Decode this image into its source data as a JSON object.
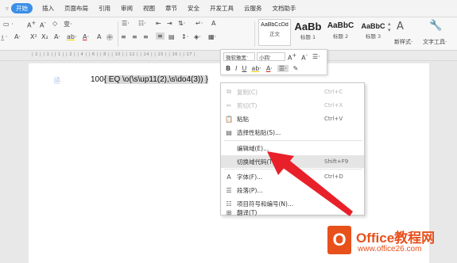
{
  "menubar": {
    "tabs": [
      "开始",
      "插入",
      "页面布局",
      "引用",
      "审阅",
      "视图",
      "章节",
      "安全",
      "开发工具",
      "云服务",
      "文档助手"
    ],
    "active_tab": "开始",
    "accent": "#3a8ee6"
  },
  "ribbon": {
    "styles": [
      {
        "sample": "AaBbCcDd",
        "name": "正文"
      },
      {
        "sample": "AaBb",
        "name": "标题 1"
      },
      {
        "sample": "AaBbC",
        "name": "标题 2"
      },
      {
        "sample": "AaBbC",
        "name": "标题 3"
      }
    ],
    "new_style_label": "新样式",
    "text_tools_label": "文字工具"
  },
  "ruler": {
    "marks": "| 2 | | 1 | | 1 | | 2 | | 4 | | 6 | | 8 | | 10 | | 12 | | 14 | | 15 | | 16 | | 17 |"
  },
  "document": {
    "line_prefix": "100",
    "field_code": "{ EQ \\o(\\s\\up11(2),\\s\\do4(3)) }"
  },
  "mini_toolbar": {
    "font_name": "微软雅黑",
    "font_size": "小四"
  },
  "context_menu": {
    "items": [
      {
        "label": "复制(C)",
        "shortcut": "Ctrl+C",
        "disabled": true,
        "icon": "copy-icon"
      },
      {
        "label": "剪切(T)",
        "shortcut": "Ctrl+X",
        "disabled": true,
        "icon": "cut-icon"
      },
      {
        "label": "粘贴",
        "shortcut": "Ctrl+V",
        "disabled": false,
        "icon": "paste-icon"
      },
      {
        "label": "选择性粘贴(S)...",
        "shortcut": "",
        "disabled": false,
        "icon": "paste-special-icon"
      },
      {
        "label": "编辑域(E)...",
        "shortcut": "",
        "disabled": false,
        "icon": ""
      },
      {
        "label": "切换域代码(T)",
        "shortcut": "Shift+F9",
        "disabled": false,
        "icon": "",
        "highlighted": true
      },
      {
        "label": "字体(F)...",
        "shortcut": "Ctrl+D",
        "disabled": false,
        "icon": "font-icon"
      },
      {
        "label": "段落(P)...",
        "shortcut": "",
        "disabled": false,
        "icon": "paragraph-icon"
      },
      {
        "label": "项目符号和编号(N)...",
        "shortcut": "",
        "disabled": false,
        "icon": "bullets-icon"
      },
      {
        "label": "翻译(T)",
        "shortcut": "",
        "disabled": false,
        "icon": "translate-icon"
      }
    ]
  },
  "watermark": {
    "brand": "Office教程网",
    "url": "www.office26.com",
    "color": "#e8501c"
  }
}
